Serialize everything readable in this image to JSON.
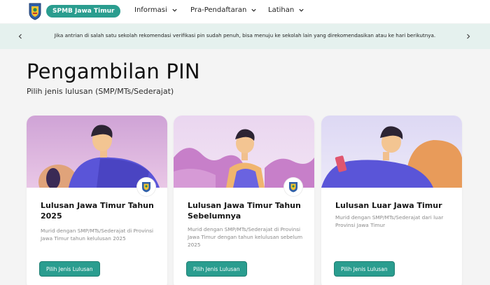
{
  "header": {
    "brand": "SPMB Jawa Timur",
    "nav": [
      {
        "label": "Informasi"
      },
      {
        "label": "Pra-Pendaftaran"
      },
      {
        "label": "Latihan"
      }
    ]
  },
  "banner": {
    "message": "Jika antrian di salah satu sekolah rekomendasi verifikasi pin sudah penuh, bisa menuju ke sekolah lain yang direkomendasikan atau ke hari berikutnya."
  },
  "page": {
    "title": "Pengambilan PIN",
    "subtitle": "Pilih jenis lulusan (SMP/MTs/Sederajat)"
  },
  "cards": [
    {
      "title": "Lulusan Jawa Timur Tahun 2025",
      "description": "Murid dengan SMP/MTs/Sederajat di Provinsi Jawa Timur tahun kelulusan 2025",
      "button": "Pilih Jenis Lulusan"
    },
    {
      "title": "Lulusan Jawa Timur Tahun Sebelumnya",
      "description": "Murid dengan SMP/MTs/Sederajat di Provinsi Jawa Timur dengan tahun kelulusan sebelum 2025",
      "button": "Pilih Jenis Lulusan"
    },
    {
      "title": "Lulusan Luar Jawa Timur",
      "description": "Murid dengan SMP/MTs/Sederajat dari luar Provinsi Jawa Timur",
      "button": "Pilih Jenis Lulusan"
    }
  ],
  "colors": {
    "primary": "#2a9d8f",
    "banner_bg": "#e5f1ee",
    "page_bg": "#f4f4f4"
  }
}
